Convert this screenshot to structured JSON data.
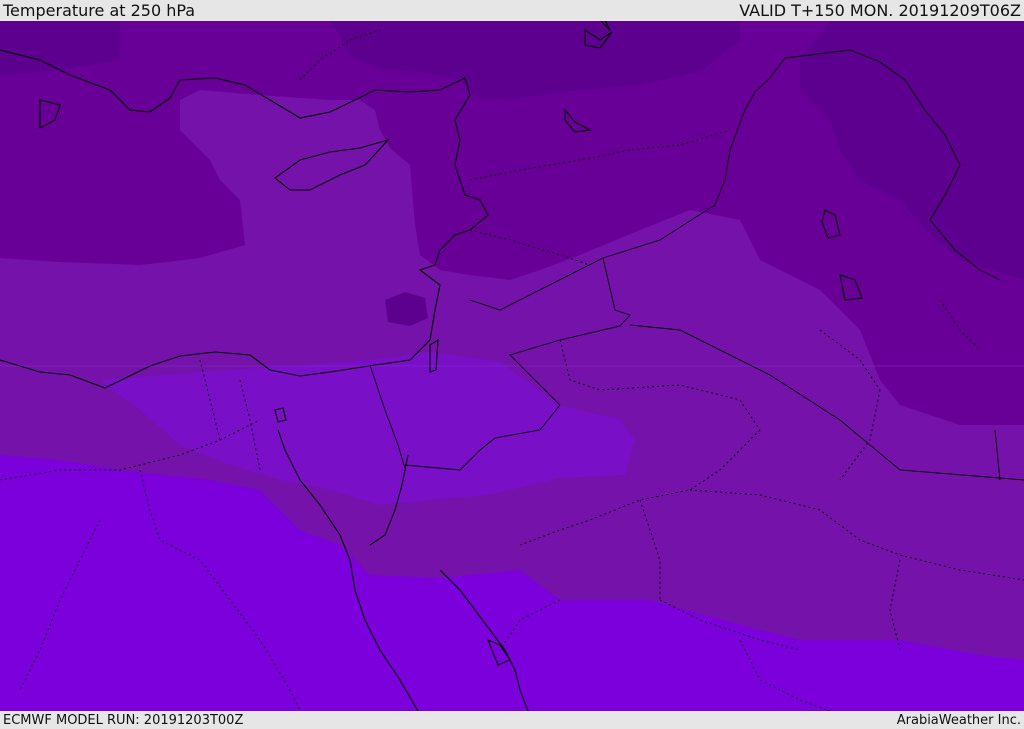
{
  "header": {
    "title": "Temperature at 250 hPa",
    "valid": "VALID T+150 MON. 20191209T06Z"
  },
  "footer": {
    "model_run": "ECMWF MODEL RUN: 20191203T00Z",
    "credit": "ArabiaWeather Inc."
  },
  "map": {
    "shading_colors": [
      "#5d0090",
      "#680098",
      "#7412aa",
      "#7a0fc8",
      "#7c00dc"
    ],
    "coastline_color": "#000000",
    "border_style": "dotted"
  }
}
